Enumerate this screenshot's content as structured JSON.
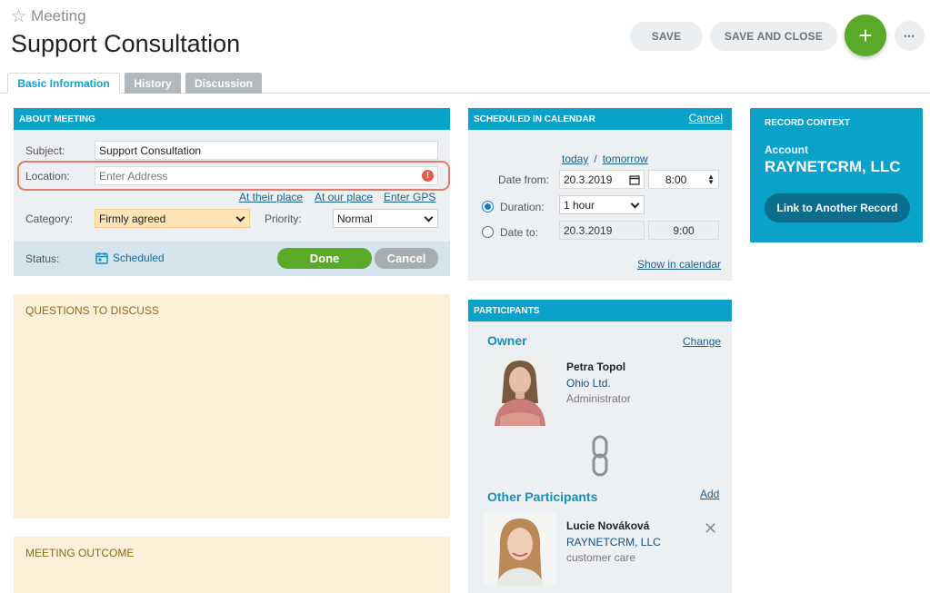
{
  "header": {
    "entity_type": "Meeting",
    "title": "Support Consultation",
    "save_label": "SAVE",
    "save_close_label": "SAVE AND CLOSE",
    "add_label": "+",
    "more_label": "•••"
  },
  "tabs": [
    {
      "label": "Basic Information"
    },
    {
      "label": "History"
    },
    {
      "label": "Discussion"
    }
  ],
  "about": {
    "title": "ABOUT MEETING",
    "subject_label": "Subject:",
    "subject_value": "Support Consultation",
    "location_label": "Location:",
    "location_placeholder": "Enter Address",
    "link_their_place": "At their place",
    "link_our_place": "At our place",
    "link_gps": "Enter GPS",
    "category_label": "Category:",
    "category_value": "Firmly agreed",
    "priority_label": "Priority:",
    "priority_value": "Normal",
    "status_label": "Status:",
    "status_value": "Scheduled",
    "done_label": "Done",
    "cancel_label": "Cancel"
  },
  "questions": {
    "title": "QUESTIONS TO DISCUSS"
  },
  "outcome": {
    "title": "MEETING OUTCOME"
  },
  "calendar": {
    "title": "SCHEDULED IN CALENDAR",
    "cancel_label": "Cancel",
    "today_label": "today",
    "separator": "/",
    "tomorrow_label": "tomorrow",
    "date_from_label": "Date from:",
    "date_from_value": "20.3.2019",
    "time_from_value": "8:00",
    "duration_label": "Duration:",
    "duration_value": "1 hour",
    "date_to_label": "Date to:",
    "date_to_value": "20.3.2019",
    "time_to_value": "9:00",
    "show_in_calendar": "Show in calendar"
  },
  "participants": {
    "title": "PARTICIPANTS",
    "owner_title": "Owner",
    "change_label": "Change",
    "owner": {
      "name": "Petra Topol",
      "company": "Ohio Ltd.",
      "role": "Administrator"
    },
    "other_title": "Other Participants",
    "add_label": "Add",
    "others": [
      {
        "name": "Lucie Nováková",
        "company": "RAYNETCRM, LLC",
        "role": "customer care"
      }
    ]
  },
  "record_context": {
    "title": "RECORD CONTEXT",
    "account_label": "Account",
    "account_name": "RAYNETCRM, LLC",
    "link_label": "Link to Another Record"
  },
  "colors": {
    "accent": "#0aa2c8",
    "green": "#5aa928",
    "note_bg": "#fdf0d8",
    "error": "#e8594c"
  }
}
